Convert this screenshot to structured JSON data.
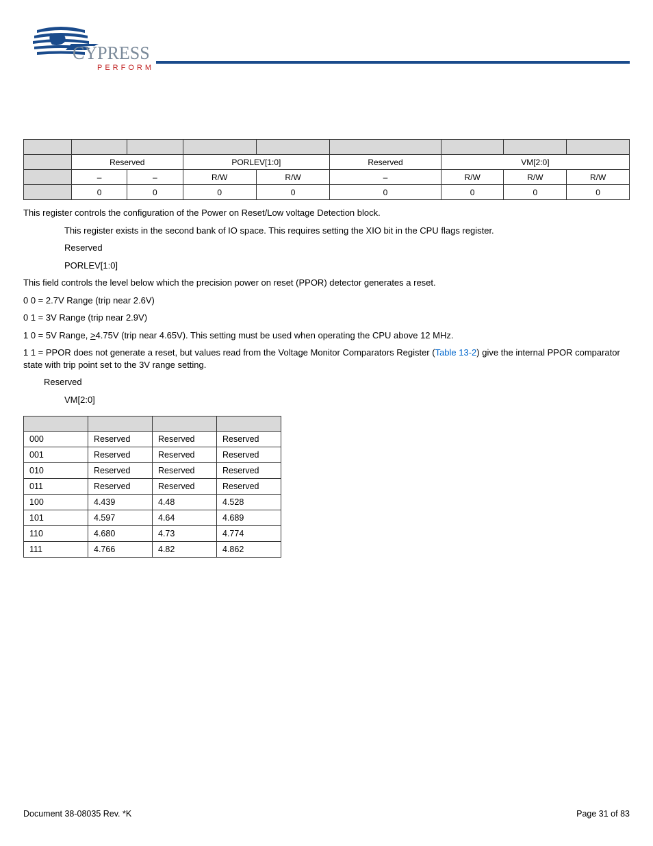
{
  "logo": {
    "brand": "CYPRESS",
    "tag": "P E R F O R M"
  },
  "register_table": {
    "row1": {
      "label": "",
      "c1": "",
      "c2": "",
      "c3": "",
      "c4": "",
      "c5": "",
      "c6": "",
      "c7": "",
      "c8": ""
    },
    "row2": {
      "label": "",
      "g1": "Reserved",
      "g2": "PORLEV[1:0]",
      "g3": "Reserved",
      "g4": "VM[2:0]"
    },
    "row3": {
      "label": "",
      "c1": "–",
      "c2": "–",
      "c3": "R/W",
      "c4": "R/W",
      "c5": "–",
      "c6": "R/W",
      "c7": "R/W",
      "c8": "R/W"
    },
    "row4": {
      "label": "",
      "c1": "0",
      "c2": "0",
      "c3": "0",
      "c4": "0",
      "c5": "0",
      "c6": "0",
      "c7": "0",
      "c8": "0"
    }
  },
  "desc": {
    "p1": "This register controls the configuration of the Power on Reset/Low voltage Detection block.",
    "p2": "This register exists in the second bank of IO space. This requires setting the XIO bit in the CPU flags register.",
    "b76": "Reserved",
    "b54": "PORLEV[1:0]",
    "p3": "This field controls the level below which the precision power on reset (PPOR) detector generates a reset.",
    "v00": "0 0 = 2.7V Range (trip near 2.6V)",
    "v01": "0 1 = 3V Range (trip near 2.9V)",
    "v10_a": "1 0 = 5V Range, ",
    "v10_b": ">",
    "v10_c": "4.75V (trip near 4.65V). This setting must be used when operating the CPU above 12 MHz.",
    "v11_a": "1 1 = PPOR does not generate a reset, but values read from the Voltage Monitor Comparators Register (",
    "v11_link": "Table 13-2",
    "v11_b": ") give the internal PPOR comparator state with trip point set to the 3V range setting.",
    "b3": "Reserved",
    "b20": "VM[2:0]"
  },
  "vm_table": {
    "h1": "",
    "h2": "",
    "h3": "",
    "h4": "",
    "rows": [
      {
        "c1": "000",
        "c2": "Reserved",
        "c3": "Reserved",
        "c4": "Reserved"
      },
      {
        "c1": "001",
        "c2": "Reserved",
        "c3": "Reserved",
        "c4": "Reserved"
      },
      {
        "c1": "010",
        "c2": "Reserved",
        "c3": "Reserved",
        "c4": "Reserved"
      },
      {
        "c1": "011",
        "c2": "Reserved",
        "c3": "Reserved",
        "c4": "Reserved"
      },
      {
        "c1": "100",
        "c2": "4.439",
        "c3": "4.48",
        "c4": "4.528"
      },
      {
        "c1": "101",
        "c2": "4.597",
        "c3": "4.64",
        "c4": "4.689"
      },
      {
        "c1": "110",
        "c2": "4.680",
        "c3": "4.73",
        "c4": "4.774"
      },
      {
        "c1": "111",
        "c2": "4.766",
        "c3": "4.82",
        "c4": "4.862"
      }
    ]
  },
  "footer": {
    "doc": "Document 38-08035 Rev. *K",
    "page": "Page 31 of 83"
  }
}
